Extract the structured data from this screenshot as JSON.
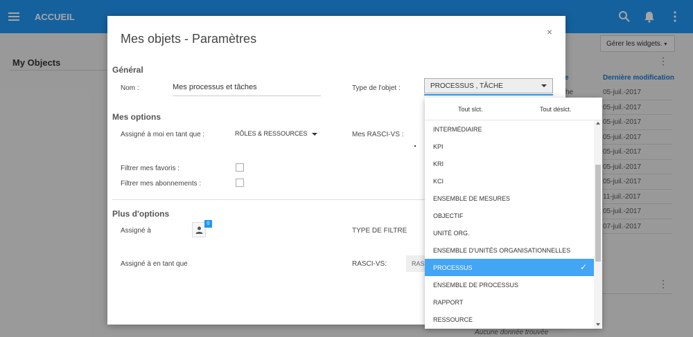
{
  "topbar": {
    "title": "ACCUEIL"
  },
  "background": {
    "title": "My Objects",
    "manage_widgets": "Gérer les widgets.",
    "col_partial": "e",
    "col_last_modified": "Dernière modification",
    "row_fragment": "he",
    "dates": [
      "05-juil.-2017",
      "05-juil.-2017",
      "05-juil.-2017",
      "05-juil.-2017",
      "05-juil.-2017",
      "05-juil.-2017",
      "05-juil.-2017",
      "11-juil.-2017",
      "05-juil.-2017",
      "07-juil.-2017"
    ],
    "empty_text": "Aucune donnée trouvée"
  },
  "modal": {
    "title": "Mes objets - Paramètres",
    "close": "×",
    "general": "Général",
    "name_label": "Nom :",
    "name_value": "Mes processus et tâches",
    "type_label": "Type de l'objet :",
    "type_value": "PROCESSUS , TÂCHE",
    "my_options": "Mes options",
    "assigned_me_label": "Assigné à moi en tant que :",
    "roles_value": "RÔLES & RESSOURCES",
    "rasci_label": "Mes RASCI-VS :",
    "favorites_label": "Filtrer mes favoris :",
    "subscriptions_label": "Filtrer mes abonnements :",
    "more_options": "Plus d'options",
    "assigned_to_label": "Assigné à",
    "user_badge": "0",
    "filter_type_label": "TYPE DE FILTRE",
    "assigned_as_label": "Assigné à en tant que",
    "rasci_vs_label": "RASCI-VS:",
    "rasci_input": "RAS"
  },
  "dropdown": {
    "select_all": "Tout slct.",
    "deselect_all": "Tout déslct.",
    "items": [
      {
        "label": "INTERMÉDIAIRE",
        "selected": false
      },
      {
        "label": "KPI",
        "selected": false
      },
      {
        "label": "KRI",
        "selected": false
      },
      {
        "label": "KCI",
        "selected": false
      },
      {
        "label": "ENSEMBLE DE MESURES",
        "selected": false
      },
      {
        "label": "OBJECTIF",
        "selected": false
      },
      {
        "label": "UNITÉ ORG.",
        "selected": false
      },
      {
        "label": "ENSEMBLE D'UNITÉS ORGANISATIONNELLES",
        "selected": false
      },
      {
        "label": "PROCESSUS",
        "selected": true
      },
      {
        "label": "ENSEMBLE DE PROCESSUS",
        "selected": false
      },
      {
        "label": "RAPPORT",
        "selected": false
      },
      {
        "label": "RESSOURCE",
        "selected": false
      }
    ],
    "check": "✓"
  },
  "colors": {
    "primary": "#2196f3",
    "selected": "#42a5f5",
    "link": "#1976d2"
  }
}
